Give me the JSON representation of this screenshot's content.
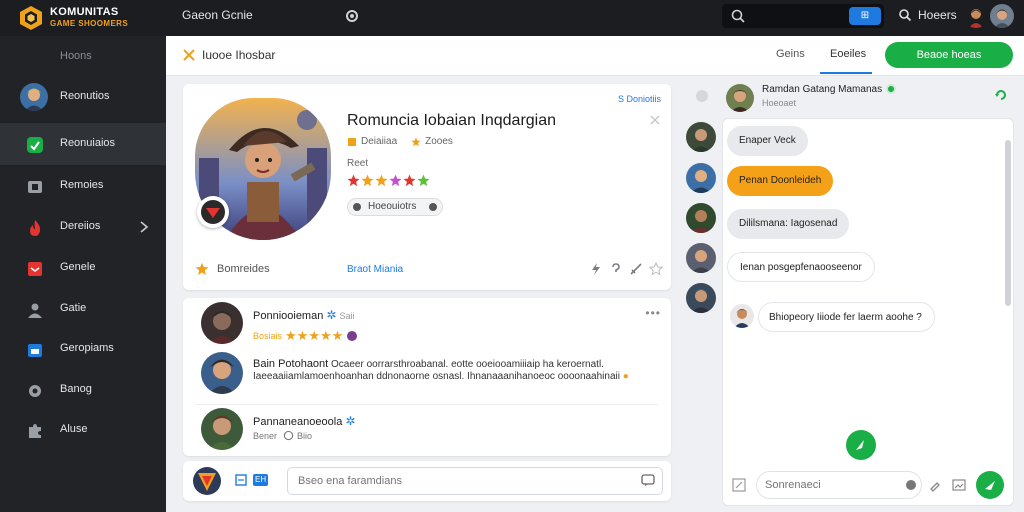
{
  "topbar": {
    "brand_name": "KOMUNITAS",
    "brand_sub": "GAME SHOOMERS",
    "title": "Gaeon Gcnie",
    "search_placeholder": "",
    "search_button": "⊞",
    "user_name": "Hoeers"
  },
  "sidebar": {
    "header": "Hoons",
    "items": [
      {
        "label": "Reonutios"
      },
      {
        "label": "Reonuiaios"
      },
      {
        "label": "Remoies"
      },
      {
        "label": "Dereiios"
      },
      {
        "label": "Genele"
      },
      {
        "label": "Gatie"
      },
      {
        "label": "Geropiams"
      },
      {
        "label": "Banog"
      },
      {
        "label": "Aluse"
      }
    ]
  },
  "main_header": {
    "title": "Iuooe Ihosbar",
    "tabs": [
      "Geins",
      "Eoeiles"
    ],
    "primary_button": "Beaoe hoeas"
  },
  "game_card": {
    "title": "Romuncia Iobaian Inqdargian",
    "meta_1": "Deiaiiaa",
    "meta_2": "Zooes",
    "rating_label": "Reet",
    "chip_text": "Hoeouiotrs",
    "corner_link": "S Doniotiis",
    "footer_label": "Bomreides",
    "footer_link": "Braot Miania"
  },
  "reviews": [
    {
      "name": "Ponniooieman",
      "badge": "Saii",
      "sub": "Bosiais",
      "text": ""
    },
    {
      "name": "Bain Potohaont",
      "badge": "",
      "sub": "",
      "text": "Ocaeer oorrarsthroabanal. eotte ooeiooamiiiaip ha keroernatl. Iaeeaaiiamlamoenhoanhan ddnonaorne osnasl. Ihnanaaanihanoeoc oooonaahinaii"
    },
    {
      "name": "Pannaneanoeoola",
      "badge": "",
      "sub": "Bener",
      "sub2": "Biio",
      "text": ""
    }
  ],
  "composer": {
    "tool_label": "EH",
    "placeholder": "Bseo ena faramdians"
  },
  "chat": {
    "name": "Ramdan Gatang Mamanas",
    "status": "Hoeoaet",
    "messages": [
      {
        "text": "Enaper Veck"
      },
      {
        "text": "Penan Doonleideh"
      },
      {
        "text": "Dililsmana: Iagosenad"
      },
      {
        "text": "Ienan posgepfenaooseenor"
      },
      {
        "text": "Bhiopeory Iiiode fer laerm aoohe ?"
      }
    ],
    "input_placeholder": "Sonrenaeci"
  },
  "colors": {
    "topbar": "#1b1d21",
    "sidebar": "#212327",
    "accent_green": "#1aae47",
    "accent_blue": "#1f7ae0",
    "accent_orange": "#f5a117"
  }
}
